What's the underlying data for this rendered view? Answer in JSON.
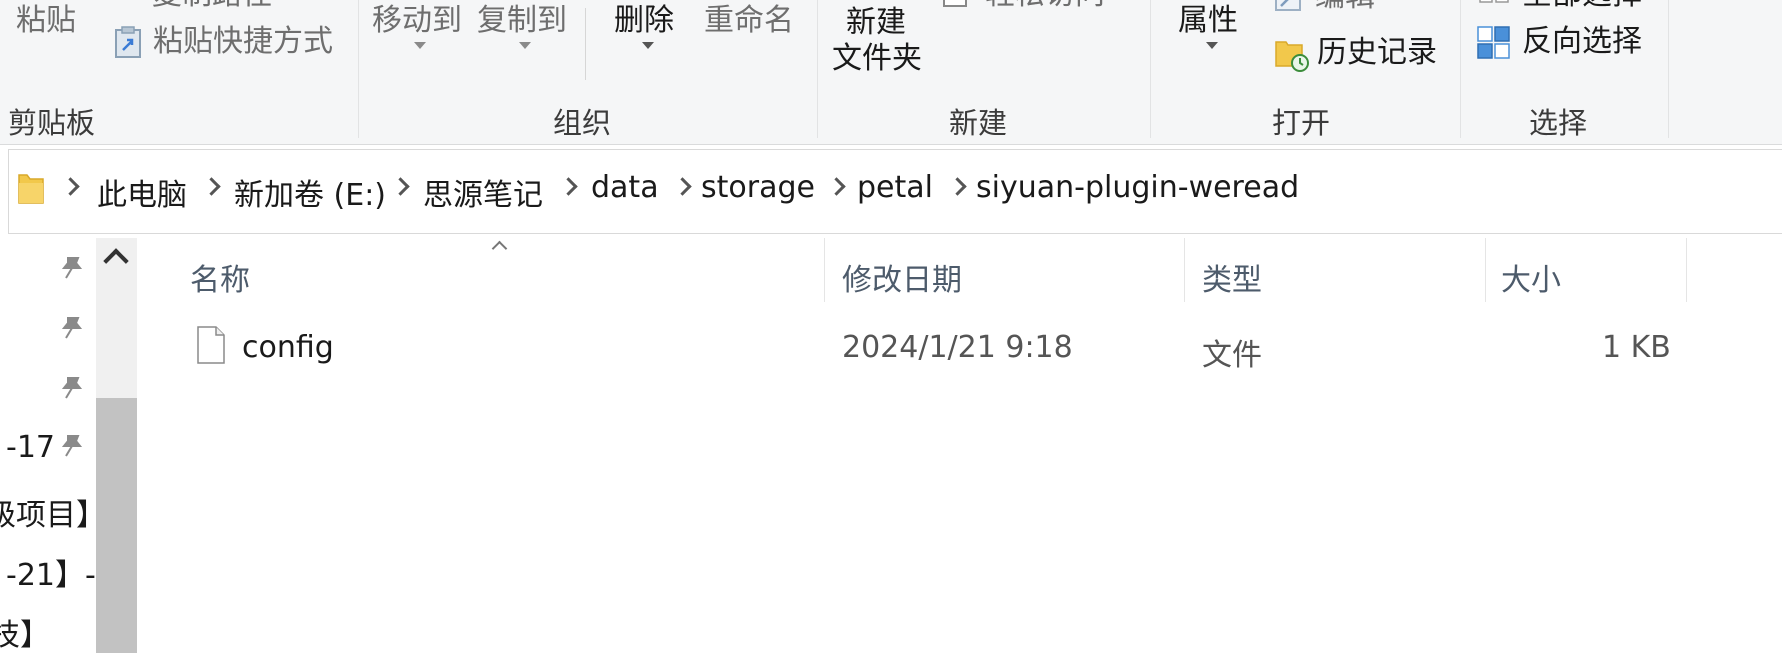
{
  "ribbon": {
    "clipboard": {
      "paste_label": "粘贴",
      "copy_path_label": "复制路径",
      "paste_shortcut_label": "粘贴快捷方式",
      "group_label": "剪贴板"
    },
    "organize": {
      "move_to_label": "移动到",
      "copy_to_label": "复制到",
      "delete_label": "删除",
      "rename_label": "重命名",
      "group_label": "组织"
    },
    "new": {
      "new_folder_line1": "新建",
      "new_folder_line2": "文件夹",
      "easy_access_label": "轻松访问",
      "group_label": "新建"
    },
    "open": {
      "properties_label": "属性",
      "edit_label": "编辑",
      "history_label": "历史记录",
      "group_label": "打开"
    },
    "select": {
      "select_all_label": "全部选择",
      "invert_selection_label": "反向选择",
      "group_label": "选择"
    }
  },
  "address": {
    "breadcrumbs": [
      "此电脑",
      "新加卷 (E:)",
      "思源笔记",
      "data",
      "storage",
      "petal",
      "siyuan-plugin-weread"
    ]
  },
  "nav": {
    "items": [
      "-17",
      "级项目】",
      "-21】-",
      "技】"
    ]
  },
  "file_list": {
    "columns": [
      "名称",
      "修改日期",
      "类型",
      "大小"
    ],
    "rows": [
      {
        "name": "config",
        "modified": "2024/1/21 9:18",
        "type": "文件",
        "size": "1 KB"
      }
    ]
  },
  "colors": {
    "ribbon_bg": "#f5f6f7",
    "header_text": "#4d5b6b",
    "folder_yellow": "#f2c84b",
    "scroll_thumb": "#c2c2c2"
  }
}
